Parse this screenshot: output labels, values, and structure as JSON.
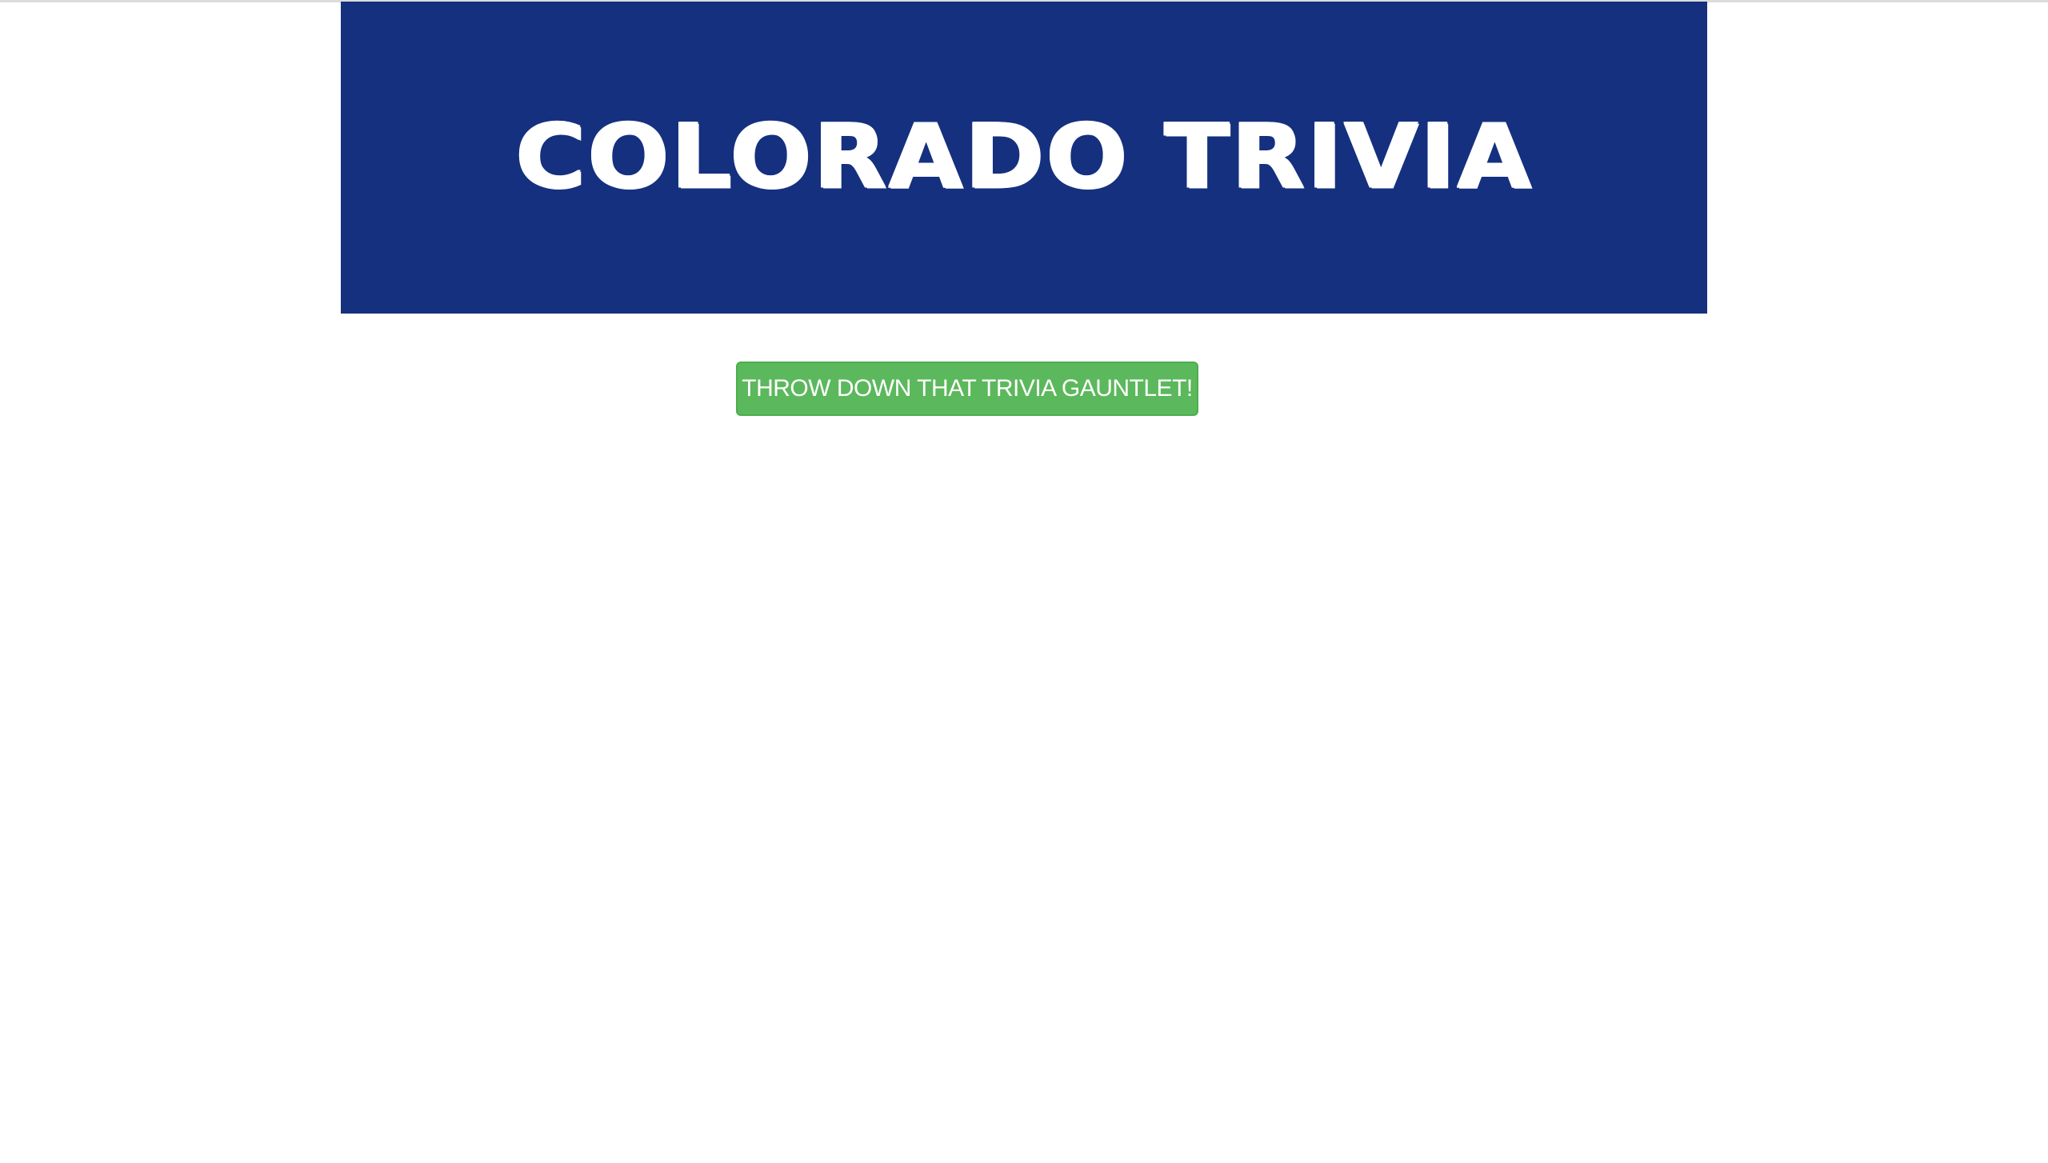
{
  "header": {
    "title": "COLORADO TRIVIA",
    "background_color": "#15307f",
    "text_color": "#ffffff"
  },
  "main": {
    "start_button_label": "THROW DOWN THAT TRIVIA GAUNTLET!",
    "start_button_color": "#5cb85c"
  }
}
